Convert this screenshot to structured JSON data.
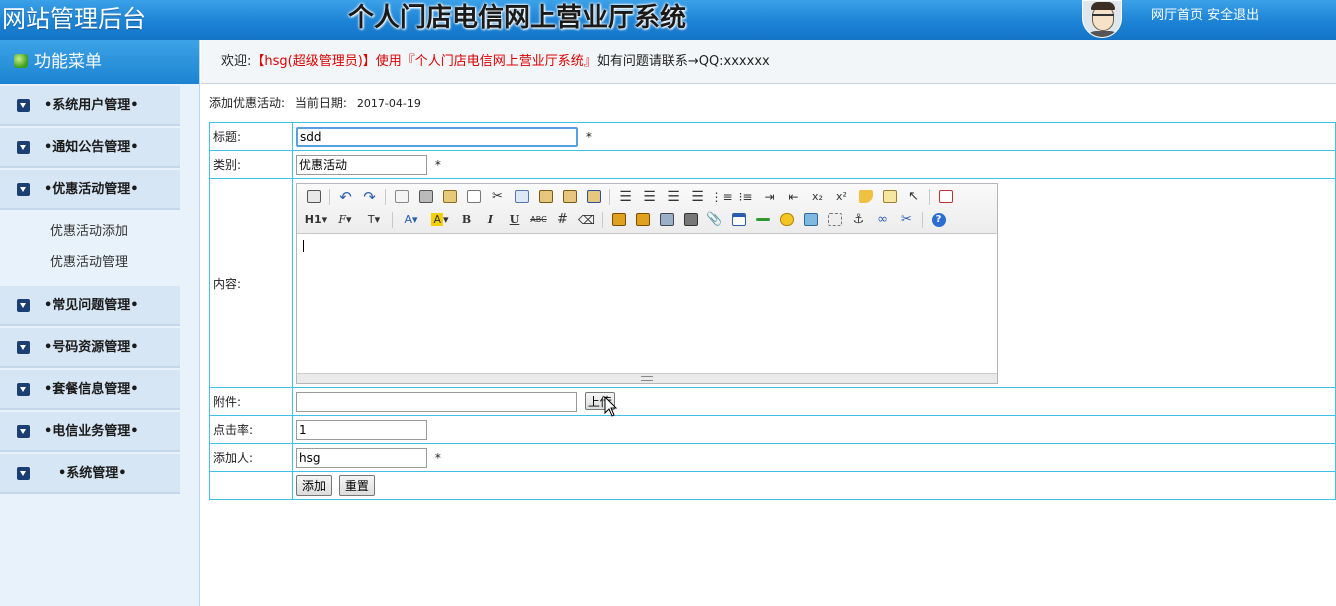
{
  "header": {
    "brand": "网站管理后台",
    "system_title": "个人门店电信网上营业厅系统",
    "home_link": "网厅首页",
    "logout_link": "安全退出"
  },
  "sidebar": {
    "title": "功能菜单",
    "groups": [
      {
        "label": "•系统用户管理•"
      },
      {
        "label": "•通知公告管理•"
      },
      {
        "label": "•优惠活动管理•",
        "items": [
          "优惠活动添加",
          "优惠活动管理"
        ]
      },
      {
        "label": "•常见问题管理•"
      },
      {
        "label": "•号码资源管理•"
      },
      {
        "label": "•套餐信息管理•"
      },
      {
        "label": "•电信业务管理•"
      },
      {
        "label": "•系统管理•"
      }
    ]
  },
  "welcome": {
    "prefix": "欢迎:",
    "user": "【hsg(超级管理员)】使用『个人门店电信网上营业厅系统』",
    "suffix": "如有问题请联系→QQ:xxxxxx"
  },
  "page": {
    "heading": "添加优惠活动:",
    "date_label": "当前日期:",
    "date_value": "2017-04-19"
  },
  "form": {
    "title_label": "标题:",
    "title_value": "sdd",
    "category_label": "类别:",
    "category_value": "优惠活动",
    "content_label": "内容:",
    "attachment_label": "附件:",
    "attachment_value": "",
    "upload_button": "上传",
    "clicks_label": "点击率:",
    "clicks_value": "1",
    "adder_label": "添加人:",
    "adder_value": "hsg",
    "required_mark": "*",
    "submit_button": "添加",
    "reset_button": "重置"
  },
  "editor_toolbar": {
    "heading_button": "H1",
    "font_family_button": "F",
    "font_size_button": "T",
    "font_color_button": "A",
    "highlight_button": "A",
    "bold_button": "B",
    "italic_button": "I",
    "underline_button": "U",
    "strike_button": "ABC",
    "subscript_button": "x₂",
    "superscript_button": "x²"
  },
  "colors": {
    "header_blue": "#1c83d6",
    "table_border": "#3fc2e6",
    "welcome_red": "#dd0000",
    "sidebar_bg": "#e8f2fb"
  }
}
